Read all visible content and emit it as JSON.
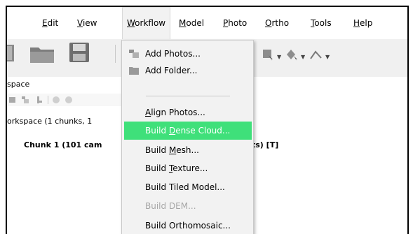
{
  "menubar": {
    "items": [
      {
        "label": "Edit",
        "mnemonic": "E",
        "rest": "dit"
      },
      {
        "label": "View",
        "mnemonic": "V",
        "rest": "iew"
      },
      {
        "label": "Workflow",
        "mnemonic": "W",
        "rest": "orkflow"
      },
      {
        "label": "Model",
        "mnemonic": "M",
        "rest": "odel"
      },
      {
        "label": "Photo",
        "mnemonic": "P",
        "rest": "hoto"
      },
      {
        "label": "Ortho",
        "mnemonic": "O",
        "rest": "rtho"
      },
      {
        "label": "Tools",
        "mnemonic": "T",
        "rest": "ools"
      },
      {
        "label": "Help",
        "mnemonic": "H",
        "rest": "elp"
      }
    ]
  },
  "workspace": {
    "panel_title": "space",
    "tree_root": "orkspace (1 chunks, 1",
    "chunk_label": "Chunk 1 (101 cam",
    "chunk_tail": "ts) [T]"
  },
  "workflow_menu": {
    "items": [
      {
        "label": "Add Photos...",
        "icon": "add-photos-icon"
      },
      {
        "label": "Add Folder...",
        "icon": "add-folder-icon"
      },
      {
        "pre": "",
        "mn": "A",
        "post": "lign Photos..."
      },
      {
        "pre": "Build ",
        "mn": "D",
        "post": "ense Cloud..."
      },
      {
        "pre": "Build ",
        "mn": "M",
        "post": "esh..."
      },
      {
        "pre": "Build ",
        "mn": "T",
        "post": "exture..."
      },
      {
        "label": "Build Tiled Model..."
      },
      {
        "label": "Build DEM..."
      },
      {
        "label": "Build Orthomosaic..."
      }
    ]
  },
  "colors": {
    "highlight": "#3fe07a",
    "toolbar_bg": "#f0f0f0",
    "menu_bg": "#f2f2f2",
    "disabled_text": "#a6a6a6"
  }
}
